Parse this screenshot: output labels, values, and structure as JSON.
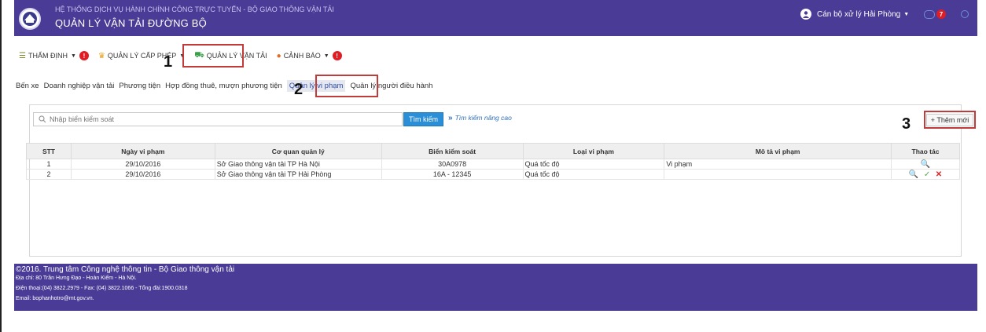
{
  "header": {
    "system_title": "HỆ THỐNG DỊCH VỤ HÀNH CHÍNH CÔNG TRỰC TUYẾN - BỘ GIAO THÔNG VẬN TẢI",
    "app_title": "QUẢN LÝ VẬN TẢI ĐƯỜNG BỘ",
    "user_name": "Cán bộ xử lý Hải Phòng",
    "notification_count": "7",
    "logo_icon": "ministry-logo-icon",
    "colors": {
      "brand": "#4a3b96",
      "badge": "#e01d24",
      "link": "#2f7fc6",
      "highlight": "#c23b3b"
    }
  },
  "menu": [
    {
      "label": "THẨM ĐỊNH",
      "badge": "!",
      "icon": "list-icon"
    },
    {
      "label": "QUẢN LÝ CẤP PHÉP",
      "icon": "certificate-icon"
    },
    {
      "label": "QUẢN LÝ VẬN TẢI",
      "icon": "truck-icon"
    },
    {
      "label": "CẢNH BÁO",
      "badge": "!",
      "icon": "alert-icon"
    }
  ],
  "submenu": [
    "Bến xe",
    "Doanh nghiệp vận tải",
    "Phương tiện",
    "Hợp đồng thuê, mượn phương tiện",
    "Quản lý vi phạm",
    "Quản lý người điều hành"
  ],
  "markers": [
    "1",
    "2",
    "3"
  ],
  "search": {
    "placeholder": "Nhập biển kiểm soát",
    "button": "Tìm kiếm",
    "advanced": "Tìm kiếm nâng cao",
    "advanced_chevron": "»"
  },
  "add_button": "+ Thêm mới",
  "table": {
    "headers": [
      "STT",
      "Ngày vi phạm",
      "Cơ quan quản lý",
      "Biển kiểm soát",
      "Loại vi phạm",
      "Mô tả vi phạm",
      "Thao tác"
    ],
    "rows": [
      [
        "1",
        "29/10/2016",
        "Sở Giao thông vận tải TP Hà Nội",
        "30A0978",
        "Quá tốc độ",
        "Vi phạm"
      ],
      [
        "2",
        "29/10/2016",
        "Sở Giao thông vận tải TP Hải Phòng",
        "16A - 12345",
        "Quá tốc độ",
        ""
      ]
    ]
  },
  "footer": {
    "line1": "©2016. Trung tâm Công nghệ thông tin - Bộ Giao thông vận tải",
    "line2": "Địa chỉ: 80 Trần Hưng Đạo - Hoàn Kiếm - Hà Nội.",
    "line3": "Điện thoại:(04) 3822.2979 - Fax: (04) 3822.1066 - Tổng đài:1900.0318",
    "line4": "Email: bophanhotro@mt.gov.vn."
  }
}
